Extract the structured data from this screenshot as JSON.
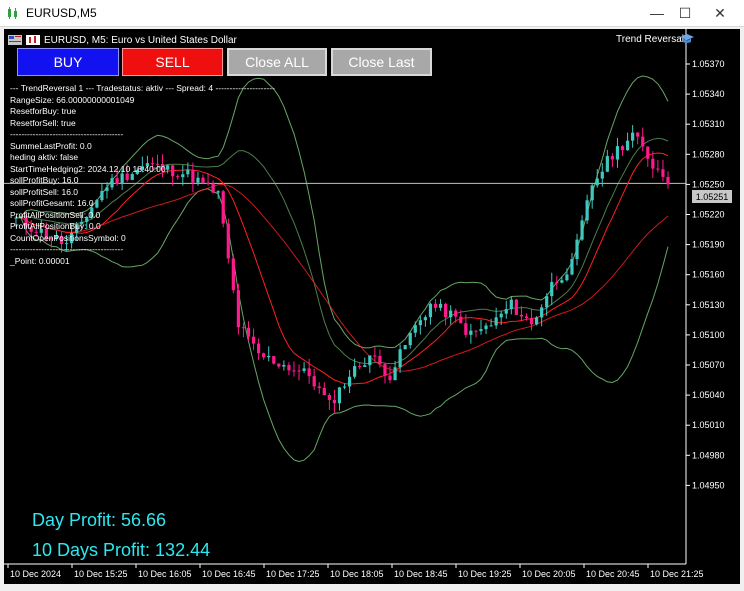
{
  "window": {
    "title": "EURUSD,M5",
    "controls": {
      "minimize": "—",
      "maximize": "☐",
      "close": "✕"
    }
  },
  "chart": {
    "symbol_line": "EURUSD, M5:  Euro vs United States Dollar",
    "indicator_name": "Trend Reversal",
    "price_labels": [
      "1.05370",
      "1.05340",
      "1.05310",
      "1.05280",
      "1.05250",
      "1.05220",
      "1.05190",
      "1.05160",
      "1.05130",
      "1.05100",
      "1.05070",
      "1.05040",
      "1.05010",
      "1.04980",
      "1.04950"
    ],
    "current_price": "1.05251",
    "time_labels": [
      "10 Dec 2024",
      "10 Dec 15:25",
      "10 Dec 16:05",
      "10 Dec 16:45",
      "10 Dec 17:25",
      "10 Dec 18:05",
      "10 Dec 18:45",
      "10 Dec 19:25",
      "10 Dec 20:05",
      "10 Dec 20:45",
      "10 Dec 21:25"
    ],
    "colors": {
      "background": "#000000",
      "bull": "#3fc8c0",
      "bear": "#ff1a8c",
      "grid_line": "#c0c0c0",
      "bands": "#7fd07f",
      "ma": "#ff2020"
    }
  },
  "toolbar": {
    "buy_label": "BUY",
    "sell_label": "SELL",
    "close_all_label": "Close ALL",
    "close_last_label": "Close Last"
  },
  "info": {
    "lines": [
      "--- TrendReversal 1 --- Tradestatus: aktiv --- Spread: 4 ---------------------",
      "RangeSize: 66.00000000001049",
      "ResetforBuy: true",
      "ResetforSell: true",
      "----------------------------------------",
      "SummeLastProfit: 0.0",
      "heding aktiv: false",
      "StartTimeHedging2: 2024.12.10 18:40:00",
      "sollProfitBuy: 16.0",
      "sollProfitSell: 16.0",
      "sollProfitGesamt: 16.0",
      "ProfitAllPositionSell: 0.0",
      "ProfitAllPositionBuy: 0.0",
      "CountOpenPositionsSymbol: 0",
      "----------------------------------------",
      "_Point: 0.00001"
    ]
  },
  "profit": {
    "day": "Day Profit: 56.66",
    "days10": "10 Days Profit: 132.44"
  }
}
